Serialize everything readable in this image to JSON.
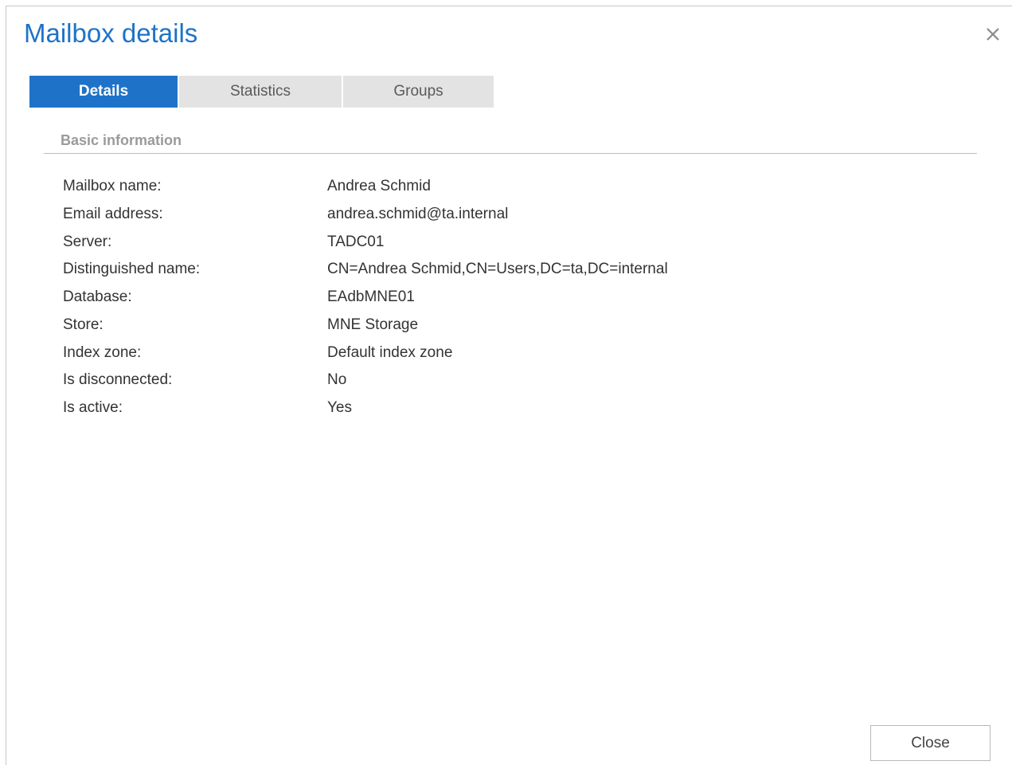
{
  "dialog": {
    "title": "Mailbox details",
    "close_icon": "close-icon"
  },
  "tabs": [
    {
      "label": "Details",
      "active": true
    },
    {
      "label": "Statistics",
      "active": false
    },
    {
      "label": "Groups",
      "active": false
    }
  ],
  "section": {
    "title": "Basic information"
  },
  "fields": [
    {
      "label": "Mailbox name:",
      "value": "Andrea Schmid"
    },
    {
      "label": "Email address:",
      "value": "andrea.schmid@ta.internal"
    },
    {
      "label": "Server:",
      "value": "TADC01"
    },
    {
      "label": "Distinguished name:",
      "value": "CN=Andrea Schmid,CN=Users,DC=ta,DC=internal"
    },
    {
      "label": "Database:",
      "value": "EAdbMNE01"
    },
    {
      "label": "Store:",
      "value": "MNE Storage"
    },
    {
      "label": "Index zone:",
      "value": "Default index zone"
    },
    {
      "label": "Is disconnected:",
      "value": "No"
    },
    {
      "label": "Is active:",
      "value": "Yes"
    }
  ],
  "footer": {
    "close_label": "Close"
  },
  "colors": {
    "accent": "#1e73c8",
    "tab_inactive": "#e3e3e3",
    "section_title": "#9a9a9a"
  }
}
